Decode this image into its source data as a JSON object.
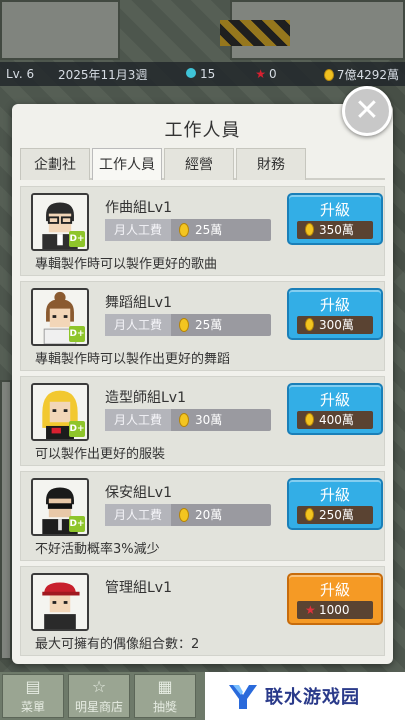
{
  "status_bar": {
    "level": "Lv. 6",
    "date": "2025年11月3週",
    "gems": "15",
    "stars": "0",
    "money": "7億4292萬"
  },
  "modal": {
    "title": "工作人員",
    "tabs": [
      {
        "label": "企劃社",
        "active": false
      },
      {
        "label": "工作人員",
        "active": true
      },
      {
        "label": "經營",
        "active": false
      },
      {
        "label": "財務",
        "active": false
      }
    ],
    "salary_label": "月人工費",
    "upgrade_label": "升級",
    "staff": [
      {
        "name": "作曲組Lv1",
        "salary": "25萬",
        "cost": "350萬",
        "cost_type": "coin",
        "button_color": "blue",
        "desc": "專輯製作時可以製作更好的歌曲",
        "badge": "D+"
      },
      {
        "name": "舞蹈組Lv1",
        "salary": "25萬",
        "cost": "300萬",
        "cost_type": "coin",
        "button_color": "blue",
        "desc": "專輯製作時可以製作出更好的舞蹈",
        "badge": "D+"
      },
      {
        "name": "造型師組Lv1",
        "salary": "30萬",
        "cost": "400萬",
        "cost_type": "coin",
        "button_color": "blue",
        "desc": "可以製作出更好的服裝",
        "badge": "D+"
      },
      {
        "name": "保安組Lv1",
        "salary": "20萬",
        "cost": "250萬",
        "cost_type": "coin",
        "button_color": "blue",
        "desc": "不好活動概率3%減少",
        "badge": "D+"
      },
      {
        "name": "管理組Lv1",
        "salary": null,
        "cost": "1000",
        "cost_type": "star",
        "button_color": "orange",
        "desc": "最大可擁有的偶像組合數：2",
        "badge": null
      }
    ]
  },
  "bottom_nav": {
    "items": [
      {
        "label": "菜單",
        "icon": "menu-icon"
      },
      {
        "label": "明星商店",
        "icon": "star-shop-icon"
      },
      {
        "label": "抽獎",
        "icon": "gift-icon"
      }
    ]
  },
  "watermark": {
    "text": "联水游戏园"
  },
  "colors": {
    "upgrade_blue": "#33aee6",
    "upgrade_orange": "#f59a25",
    "panel_bg": "#f1f1ec"
  }
}
